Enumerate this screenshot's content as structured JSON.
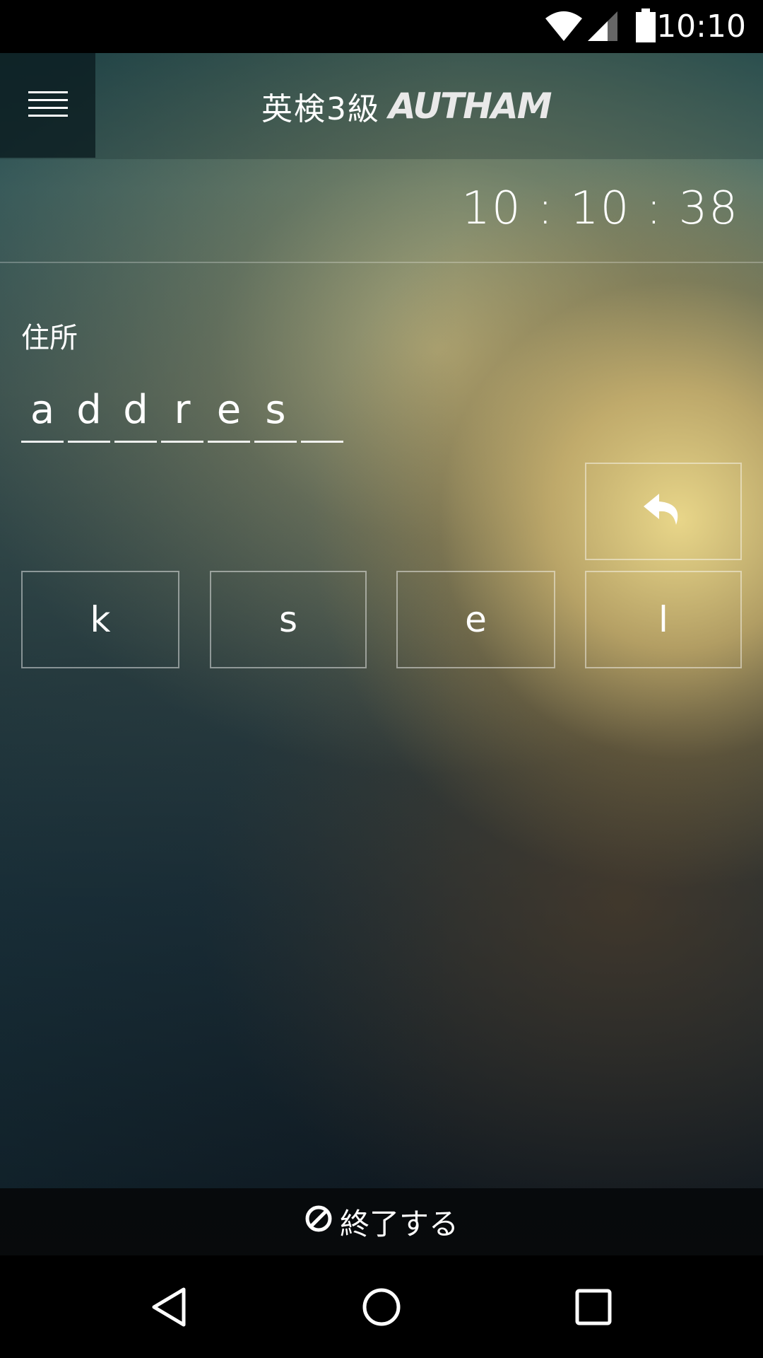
{
  "status_bar": {
    "time": "10:10",
    "icons": [
      "wifi-icon",
      "cell-signal-icon",
      "battery-icon"
    ]
  },
  "app_bar": {
    "menu_icon": "hamburger-menu-icon",
    "title": "英検3級",
    "logo_text": "AUTHAM"
  },
  "timer": {
    "value": "10 : 10 : 38"
  },
  "quiz": {
    "prompt": "住所",
    "answer_letters": [
      "a",
      "d",
      "d",
      "r",
      "e",
      "s",
      ""
    ],
    "undo_icon": "undo-arrow-icon",
    "choices": [
      "k",
      "s",
      "e",
      "l"
    ]
  },
  "footer": {
    "end_icon": "stop-circle-icon",
    "end_label": "終了する"
  },
  "nav_bar": {
    "back_icon": "back-triangle-icon",
    "home_icon": "home-circle-icon",
    "recents_icon": "recents-square-icon"
  },
  "colors": {
    "accent_glow": "#f0dc8c",
    "teal_dark": "#2f5a5b",
    "bottom_dark": "#0f1820"
  }
}
